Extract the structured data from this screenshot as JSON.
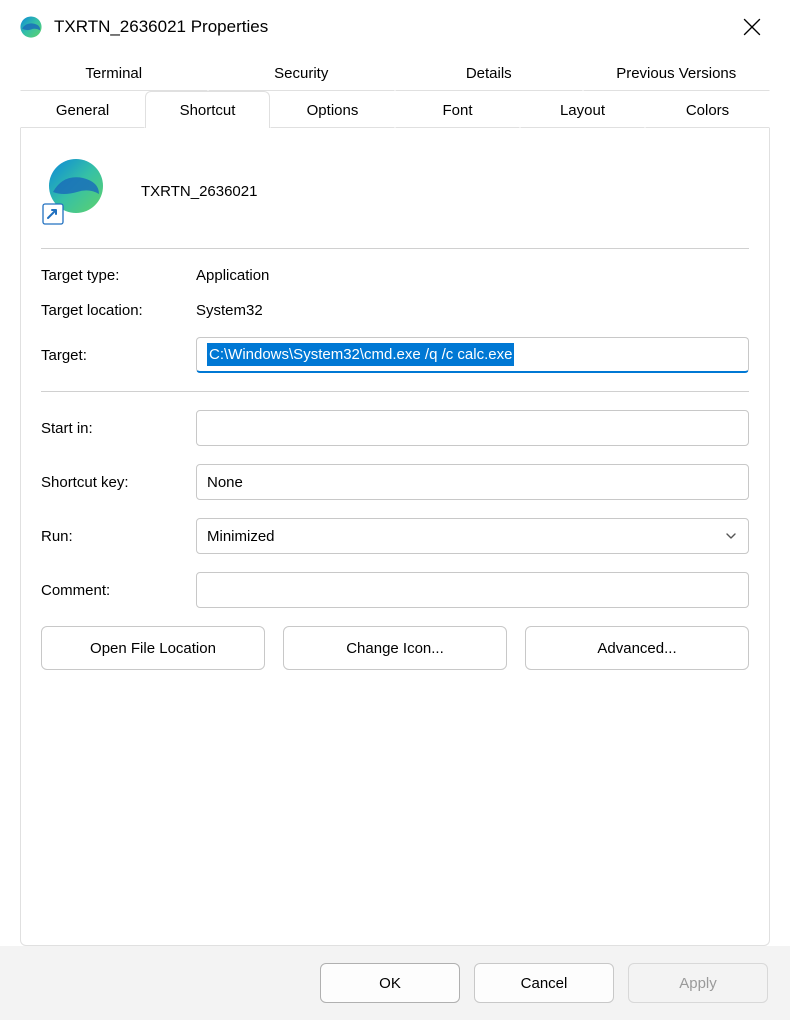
{
  "window": {
    "title": "TXRTN_2636021 Properties"
  },
  "tabsTop": [
    "Terminal",
    "Security",
    "Details",
    "Previous Versions"
  ],
  "tabsBottom": [
    "General",
    "Shortcut",
    "Options",
    "Font",
    "Layout",
    "Colors"
  ],
  "appName": "TXRTN_2636021",
  "fields": {
    "targetTypeLabel": "Target type:",
    "targetTypeValue": "Application",
    "targetLocationLabel": "Target location:",
    "targetLocationValue": "System32",
    "targetLabel": "Target:",
    "targetValue": "C:\\Windows\\System32\\cmd.exe /q /c calc.exe",
    "startInLabel": "Start in:",
    "startInValue": "",
    "shortcutKeyLabel": "Shortcut key:",
    "shortcutKeyValue": "None",
    "runLabel": "Run:",
    "runValue": "Minimized",
    "commentLabel": "Comment:",
    "commentValue": ""
  },
  "buttons": {
    "openFileLocation": "Open File Location",
    "changeIcon": "Change Icon...",
    "advanced": "Advanced...",
    "ok": "OK",
    "cancel": "Cancel",
    "apply": "Apply"
  }
}
